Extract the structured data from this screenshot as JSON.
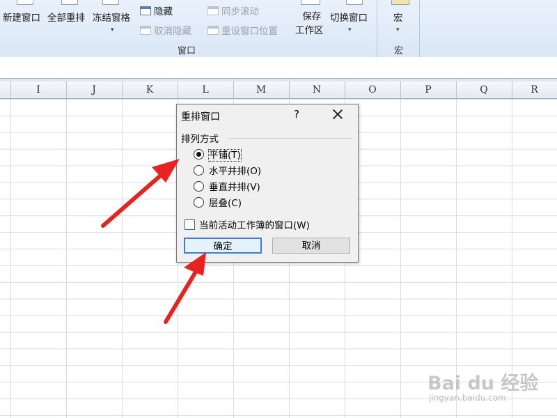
{
  "ribbon": {
    "window_group": {
      "new_window": "新建窗口",
      "arrange_all": "全部重排",
      "freeze_panes": "冻结窗格",
      "hide": "隐藏",
      "unhide": "取消隐藏",
      "sync_scroll": "同步滚动",
      "reset_position": "重设窗口位置",
      "save_workspace_line1": "保存",
      "save_workspace_line2": "工作区",
      "switch_windows": "切换窗口",
      "label": "窗口"
    },
    "macro_group": {
      "macros": "宏",
      "label": "宏"
    }
  },
  "columns": [
    "I",
    "J",
    "K",
    "L",
    "M",
    "N",
    "O",
    "P",
    "Q",
    "R"
  ],
  "dialog": {
    "title": "重排窗口",
    "help": "?",
    "group_title": "排列方式",
    "options": [
      {
        "label": "平铺(T)",
        "selected": true
      },
      {
        "label": "水平并排(O)",
        "selected": false
      },
      {
        "label": "垂直并排(V)",
        "selected": false
      },
      {
        "label": "层叠(C)",
        "selected": false
      }
    ],
    "checkbox_label": "当前活动工作簿的窗口(W)",
    "checkbox_checked": false,
    "ok_label": "确定",
    "cancel_label": "取消"
  },
  "annotations": {
    "arrow_color": "#e8231f"
  },
  "watermark": {
    "main": "Bai du 经验",
    "sub": "jingyan.baidu.com"
  }
}
